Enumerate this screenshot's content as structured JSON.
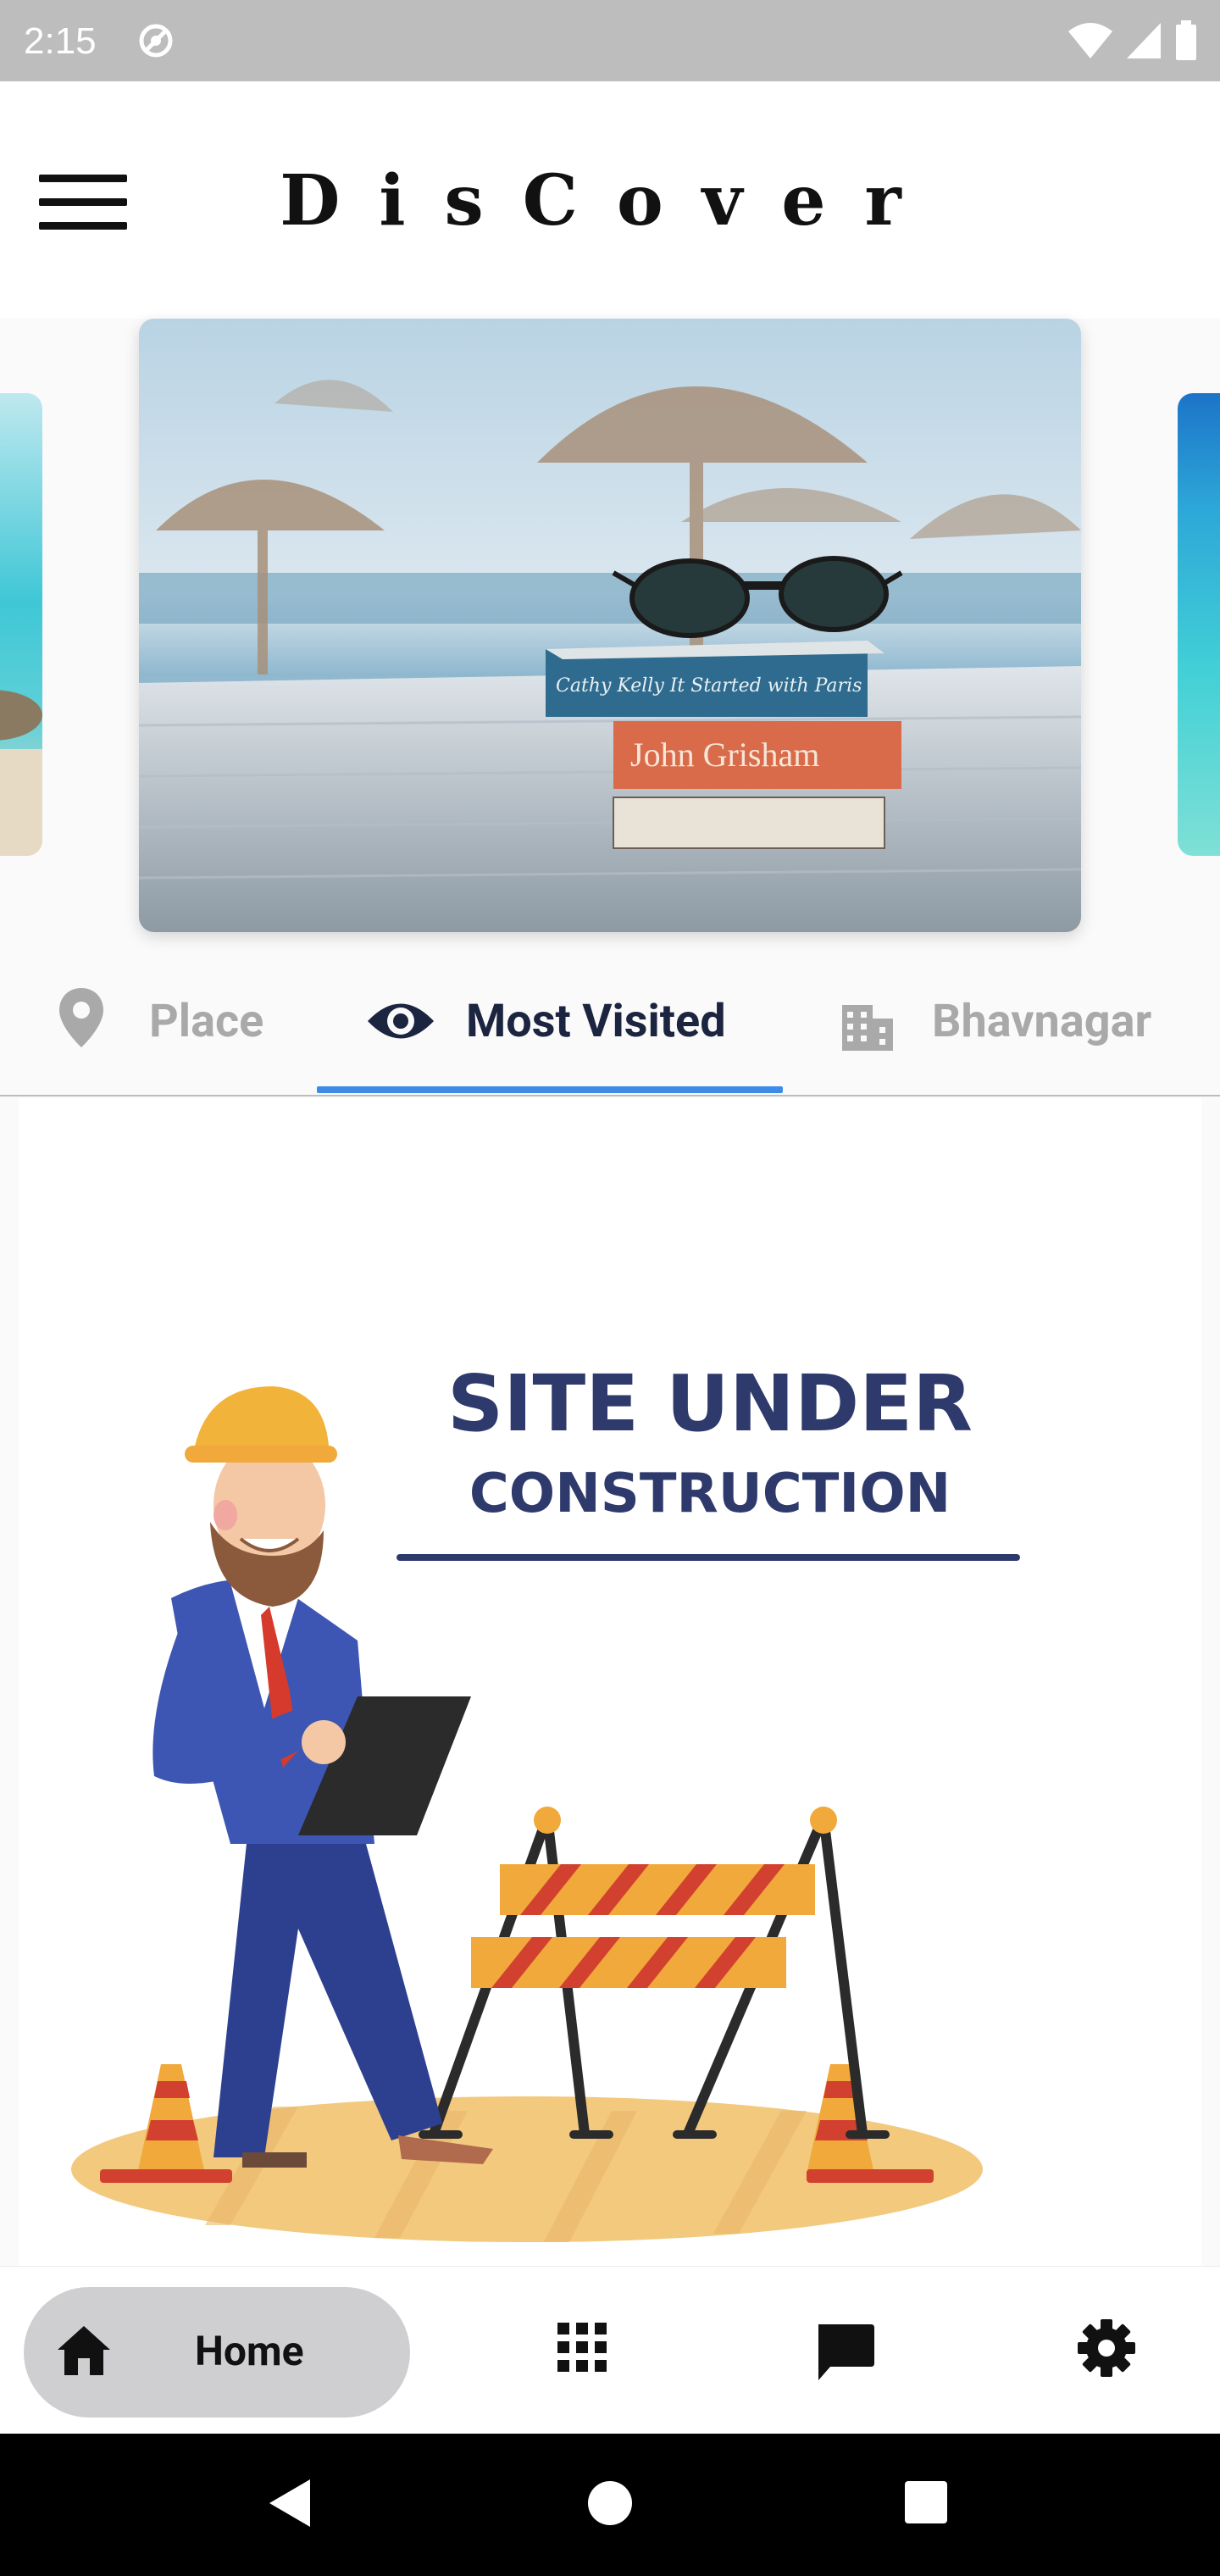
{
  "status_bar": {
    "time": "2:15",
    "icons": [
      "sync-icon",
      "wifi-icon",
      "signal-icon",
      "battery-icon"
    ]
  },
  "app_bar": {
    "title": "DisCover",
    "menu_icon": "hamburger-menu-icon"
  },
  "carousel": {
    "slides": [
      {
        "name": "beach-turquoise-left",
        "type": "image"
      },
      {
        "name": "beach-books-sunglasses",
        "type": "image",
        "visible_text": [
          "Cathy Kelly",
          "It Started with Paris",
          "John Grisham"
        ]
      },
      {
        "name": "beach-turquoise-right",
        "type": "image"
      }
    ]
  },
  "tabs": {
    "items": [
      {
        "label": "Place",
        "icon": "location-pin-icon",
        "selected": false
      },
      {
        "label": "Most Visited",
        "icon": "eye-icon",
        "selected": true
      },
      {
        "label": "Bhavnagar",
        "icon": "city-building-icon",
        "selected": false
      }
    ]
  },
  "content": {
    "headline_line1": "SITE UNDER",
    "headline_line2": "CONSTRUCTION",
    "illustration": "site-under-construction-illustration"
  },
  "bottom_nav": {
    "items": [
      {
        "label": "Home",
        "icon": "home-icon",
        "selected": true
      },
      {
        "label": "",
        "icon": "grid-apps-icon",
        "selected": false
      },
      {
        "label": "",
        "icon": "chat-bubble-icon",
        "selected": false
      },
      {
        "label": "",
        "icon": "settings-gear-icon",
        "selected": false
      }
    ]
  },
  "system_nav": [
    "back-icon",
    "home-circle-icon",
    "recents-icon"
  ],
  "colors": {
    "accent": "#3c8ce7",
    "tab_active": "#1c2540",
    "tab_inactive": "#a9a9a9",
    "status_bar": "#bdbdbd",
    "headline": "#2e3a6b",
    "home_pill": "#cfcfd2"
  }
}
